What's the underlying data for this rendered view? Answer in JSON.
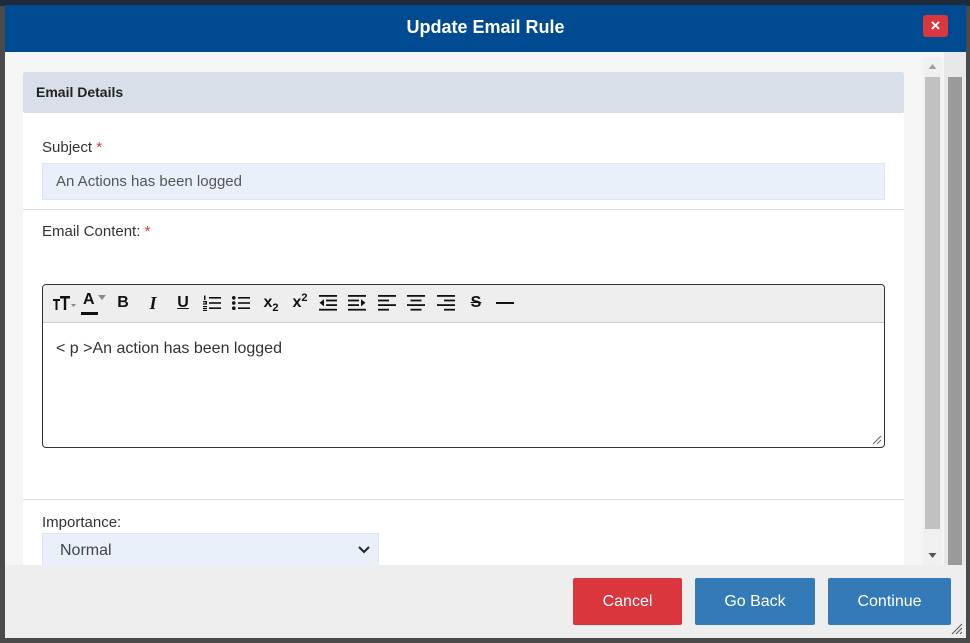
{
  "dialog": {
    "title": "Update Email Rule",
    "close_label": "×"
  },
  "section": {
    "title": "Email Details"
  },
  "subject": {
    "label": "Subject",
    "required_mark": "*",
    "value": "An Actions has been logged"
  },
  "email_content": {
    "label": "Email Content:",
    "required_mark": "*",
    "body_text": "< p >An action has been logged",
    "toolbar": {
      "bold": "B",
      "italic": "I",
      "underline": "U",
      "font_color": "A",
      "subscript": "x",
      "subscript_digit": "2",
      "superscript": "x",
      "superscript_digit": "2",
      "strikethrough": "S"
    }
  },
  "importance": {
    "label": "Importance:",
    "selected": "Normal"
  },
  "footer": {
    "cancel": "Cancel",
    "go_back": "Go Back",
    "continue": "Continue"
  },
  "colors": {
    "titlebar": "#004a91",
    "danger": "#d9363e",
    "primary": "#337ab7",
    "section_header": "#d8dfe8",
    "input_bg": "#e9f0f9"
  }
}
